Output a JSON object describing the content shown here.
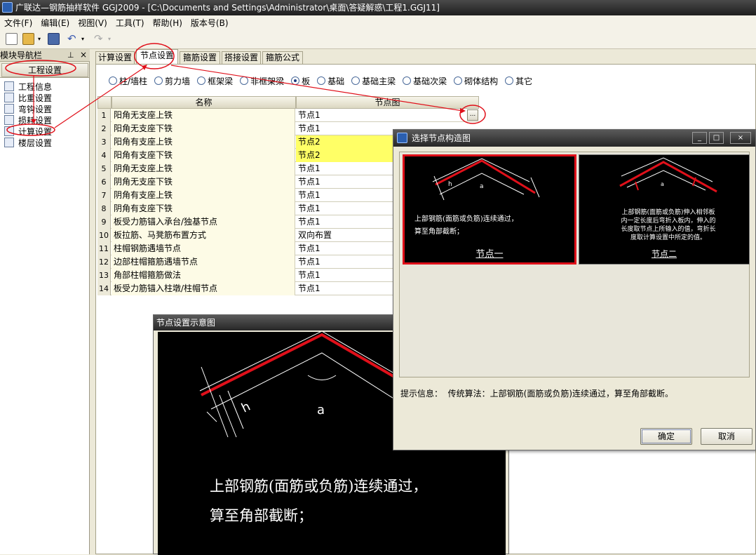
{
  "window": {
    "title": "广联达—钢筋抽样软件 GGJ2009 - [C:\\Documents and Settings\\Administrator\\桌面\\答疑解惑\\工程1.GGJ11]"
  },
  "menu": [
    "文件(F)",
    "编辑(E)",
    "视图(V)",
    "工具(T)",
    "帮助(H)",
    "版本号(B)"
  ],
  "nav": {
    "title": "模块导航栏",
    "pin": "ᵖ",
    "close": "×",
    "group": "工程设置",
    "items": [
      "工程信息",
      "比重设置",
      "弯钩设置",
      "损耗设置",
      "计算设置",
      "楼层设置"
    ]
  },
  "tabs": [
    "计算设置",
    "节点设置",
    "箍筋设置",
    "搭接设置",
    "箍筋公式"
  ],
  "active_tab": "节点设置",
  "radios": [
    "柱/墙柱",
    "剪力墙",
    "框架梁",
    "非框架梁",
    "板",
    "基础",
    "基础主梁",
    "基础次梁",
    "砌体结构",
    "其它"
  ],
  "selected_radio": "板",
  "grid": {
    "headers": [
      "名称",
      "节点图"
    ],
    "rows": [
      {
        "no": "1",
        "name": "阳角无支座上铁",
        "node": "节点1"
      },
      {
        "no": "2",
        "name": "阳角无支座下铁",
        "node": "节点1"
      },
      {
        "no": "3",
        "name": "阳角有支座上铁",
        "node": "节点2"
      },
      {
        "no": "4",
        "name": "阳角有支座下铁",
        "node": "节点2"
      },
      {
        "no": "5",
        "name": "阴角无支座上铁",
        "node": "节点1"
      },
      {
        "no": "6",
        "name": "阴角无支座下铁",
        "node": "节点1"
      },
      {
        "no": "7",
        "name": "阴角有支座上铁",
        "node": "节点1"
      },
      {
        "no": "8",
        "name": "阴角有支座下铁",
        "node": "节点1"
      },
      {
        "no": "9",
        "name": "板受力筋锚入承台/独基节点",
        "node": "节点1"
      },
      {
        "no": "10",
        "name": "板拉筋、马凳筋布置方式",
        "node": "双向布置"
      },
      {
        "no": "11",
        "name": "柱帽钢筋遇墙节点",
        "node": "节点1"
      },
      {
        "no": "12",
        "name": "边部柱帽箍筋遇墙节点",
        "node": "节点1"
      },
      {
        "no": "13",
        "name": "角部柱帽箍筋做法",
        "node": "节点1"
      },
      {
        "no": "14",
        "name": "板受力筋锚入柱墩/柱帽节点",
        "node": "节点1"
      }
    ],
    "highlight_color": "#ffff66",
    "name_bg": "#fdfbe6"
  },
  "ellipsis": "...",
  "select_dialog": {
    "title": "选择节点构造图",
    "choice1": {
      "text1": "上部钢筋(面筋或负筋)连续通过，",
      "text2": "算至角部截断；",
      "caption": "节点一",
      "label_a": "a",
      "label_h": "h"
    },
    "choice2": {
      "text1": "上部钢筋(面筋或负筋)伸入相邻板",
      "text2": "内一定长度后弯折入板内，伸入的",
      "text3": "长度取节点上所输入的值，弯折长",
      "text4": "度取计算设置中所定的值。",
      "caption": "节点二",
      "label_a": "a"
    },
    "hint_label": "提示信息：",
    "hint_text": "传统算法：上部钢筋(面筋或负筋)连续通过，算至角部截断。",
    "ok": "确定",
    "cancel": "取消",
    "min": "_",
    "max": "□",
    "close": "×"
  },
  "diagram_dialog": {
    "title": "节点设置示意图",
    "label_a": "a",
    "label_h": "h",
    "text1": "上部钢筋(面筋或负筋)连续通过，",
    "text2": "算至角部截断；"
  },
  "colors": {
    "annotation_red": "#e0101a",
    "selected_border": "#e0101a"
  }
}
